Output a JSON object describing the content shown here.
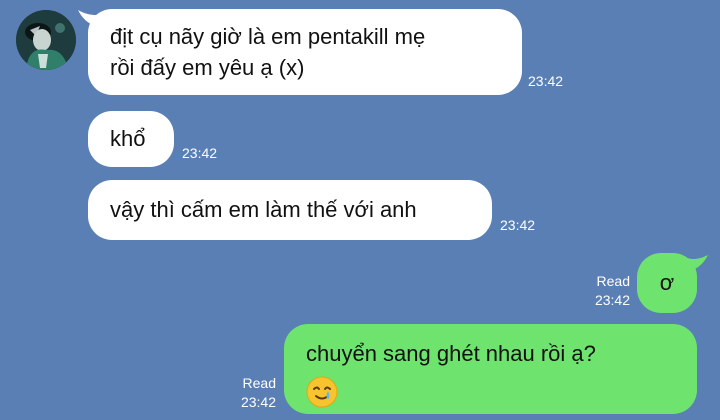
{
  "messages": [
    {
      "direction": "incoming",
      "lines": [
        "địt cụ nãy giờ là em pentakill mẹ",
        "rồi đấy em yêu ạ (x)"
      ],
      "time": "23:42"
    },
    {
      "direction": "incoming",
      "text": "khổ",
      "time": "23:42"
    },
    {
      "direction": "incoming",
      "text": "vậy thì cấm em làm thế với anh",
      "time": "23:42"
    },
    {
      "direction": "outgoing",
      "text": "ơ",
      "status": "Read",
      "time": "23:42"
    },
    {
      "direction": "outgoing",
      "text": "chuyển sang ghét nhau rồi ạ?",
      "emoji": "crying-smile-emoji",
      "status": "Read",
      "time": "23:42"
    }
  ],
  "colors": {
    "background": "#5a7fb5",
    "incoming_bubble": "#ffffff",
    "outgoing_bubble": "#6ee36e",
    "meta_text": "#ffffff"
  },
  "avatar_icon": "contact-avatar"
}
